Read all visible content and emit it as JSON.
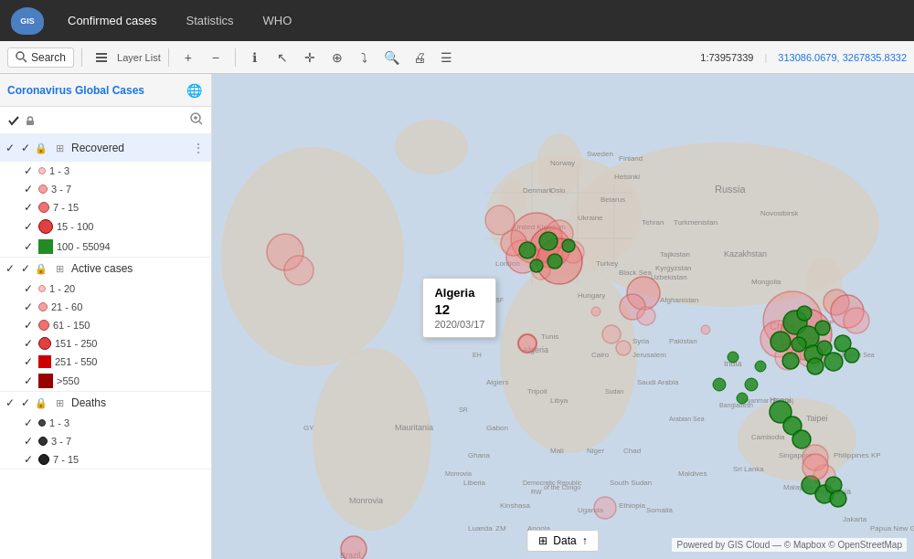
{
  "navbar": {
    "logo": "GIS",
    "items": [
      "Confirmed cases",
      "Statistics",
      "WHO"
    ]
  },
  "toolbar": {
    "search_label": "Search",
    "layer_list_label": "Layer List",
    "buttons": [
      "+",
      "−",
      "⚡",
      "ℹ",
      "↖",
      "✛",
      "⊕",
      "⤵",
      "🔍",
      "🖨",
      "☰"
    ],
    "ratio": "1:73957339",
    "coords": "313086.0679, 3267835.8332"
  },
  "panel": {
    "title": "Coronavirus Global Cases",
    "layers": [
      {
        "name": "Recovered",
        "checked": true,
        "legend": [
          {
            "range": "1 - 3",
            "type": "circle",
            "color": "#f9c5c5",
            "size": "xs"
          },
          {
            "range": "3 - 7",
            "type": "circle",
            "color": "#f5a0a0",
            "size": "sm"
          },
          {
            "range": "7 - 15",
            "type": "circle",
            "color": "#f07070",
            "size": "md"
          },
          {
            "range": "15 - 100",
            "type": "circle",
            "color": "#e04040",
            "size": "lg"
          },
          {
            "range": "100 - 55094",
            "type": "square",
            "color": "#228B22",
            "size": "xl"
          }
        ]
      },
      {
        "name": "Active cases",
        "checked": true,
        "legend": [
          {
            "range": "1 - 20",
            "type": "circle",
            "color": "#f9c5c5",
            "size": "xs"
          },
          {
            "range": "21 - 60",
            "type": "circle",
            "color": "#f5a0a0",
            "size": "sm"
          },
          {
            "range": "61 - 150",
            "type": "circle",
            "color": "#f07070",
            "size": "md"
          },
          {
            "range": "151 - 250",
            "type": "circle",
            "color": "#e04040",
            "size": "lg"
          },
          {
            "range": "251 - 550",
            "type": "square",
            "color": "#cc0000",
            "size": "xl"
          },
          {
            "range": ">550",
            "type": "square",
            "color": "#990000",
            "size": "xxl"
          }
        ]
      },
      {
        "name": "Deaths",
        "checked": true,
        "legend": [
          {
            "range": "1 - 3",
            "type": "circle",
            "color": "#333333",
            "size": "xs"
          },
          {
            "range": "3 - 7",
            "type": "circle",
            "color": "#222222",
            "size": "sm"
          },
          {
            "range": "7 - 15",
            "type": "circle",
            "color": "#111111",
            "size": "md"
          }
        ]
      }
    ]
  },
  "tooltip": {
    "country": "Algeria",
    "value": "12",
    "date": "2020/03/17"
  },
  "map": {
    "attribution": "Powered by GIS Cloud — © Mapbox © OpenStreetMap"
  },
  "data_button": {
    "icon": "⊞",
    "label": "Data",
    "arrow": "↑"
  }
}
